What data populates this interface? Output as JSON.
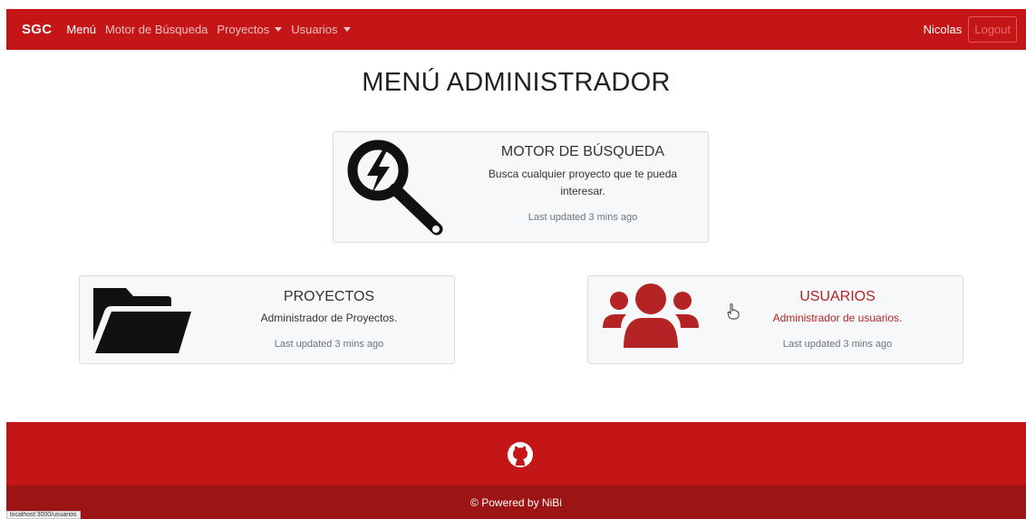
{
  "navbar": {
    "brand": "SGC",
    "items": [
      {
        "label": "Menú",
        "active": true
      },
      {
        "label": "Motor de Búsqueda",
        "active": false
      },
      {
        "label": "Proyectos",
        "dropdown": true
      },
      {
        "label": "Usuarios",
        "dropdown": true
      }
    ],
    "user": "Nicolas",
    "logout": "Logout"
  },
  "page_title": "MENÚ ADMINISTRADOR",
  "cards": {
    "search": {
      "title": "MOTOR DE BÚSQUEDA",
      "text": "Busca cualquier proyecto que te pueda interesar.",
      "updated": "Last updated 3 mins ago",
      "icon": "search-bolt-icon"
    },
    "projects": {
      "title": "PROYECTOS",
      "text": "Administrador de Proyectos.",
      "updated": "Last updated 3 mins ago",
      "icon": "folder-open-icon"
    },
    "users": {
      "title": "USUARIOS",
      "text": "Administrador de usuarios.",
      "updated": "Last updated 3 mins ago",
      "icon": "users-icon"
    }
  },
  "footer": {
    "icon": "github-icon",
    "powered": "© Powered by NiBi"
  },
  "status_url": "localhost:3000/usuarios",
  "colors": {
    "primary_red": "#c41616",
    "dark_red": "#9c1414",
    "users_icon": "#b52424"
  }
}
